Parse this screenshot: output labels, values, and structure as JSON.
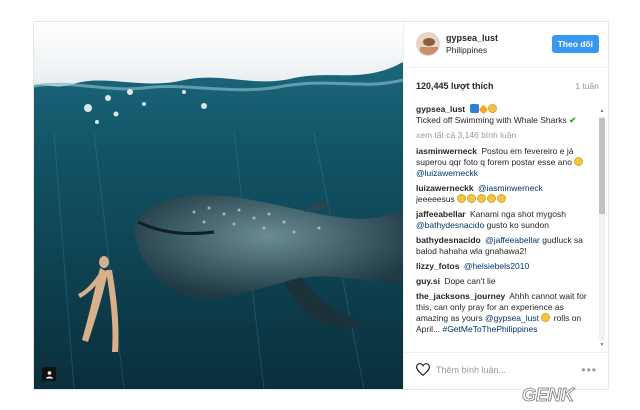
{
  "post": {
    "username": "gypsea_lust",
    "location": "Philippines",
    "follow_label": "Theo dõi",
    "likes": "120,445 lượt thích",
    "time_ago": "1 tuần",
    "caption_user": "gypsea_lust",
    "caption_text": "Ticked off Swimming with Whale Sharks",
    "view_all": "xem tất cả 3,146 bình luận",
    "add_comment_placeholder": "Thêm bình luận...",
    "more_label": "•••"
  },
  "comments": [
    {
      "user": "iasminwerneck",
      "text": "Postou em fevereiro e já superou qqr foto q forem postar esse ano",
      "mention": "@luizawerneckk"
    },
    {
      "user": "luizawerneckk",
      "mention": "@iasminwerneck",
      "text": "jeeeeesus"
    },
    {
      "user": "jaffeeabellar",
      "text": "Kanami nga shot mygosh",
      "mention": "@bathydesnacido",
      "text2": "gusto ko sundon"
    },
    {
      "user": "bathydesnacido",
      "mention": "@jaffeeabellar",
      "text": "gudluck sa balod hahaha wla gnahawa2!"
    },
    {
      "user": "lizzy_fotos",
      "mention": "@helsiebels2010"
    },
    {
      "user": "guy.si",
      "text": "Dope can't lie"
    },
    {
      "user": "the_jacksons_journey",
      "text": "Ahhh cannot wait for this, can only pray for an experience as amazing as yours",
      "mention": "@gypsea_lust",
      "text2": "rolls on April...",
      "hashtag": "#GetMeToThePhilippines"
    }
  ],
  "watermark": "GENK",
  "colors": {
    "accent": "#3897f0",
    "mention": "#003569",
    "muted": "#999999"
  },
  "icons": [
    "user-tag-icon",
    "heart-icon",
    "more-options-icon"
  ]
}
